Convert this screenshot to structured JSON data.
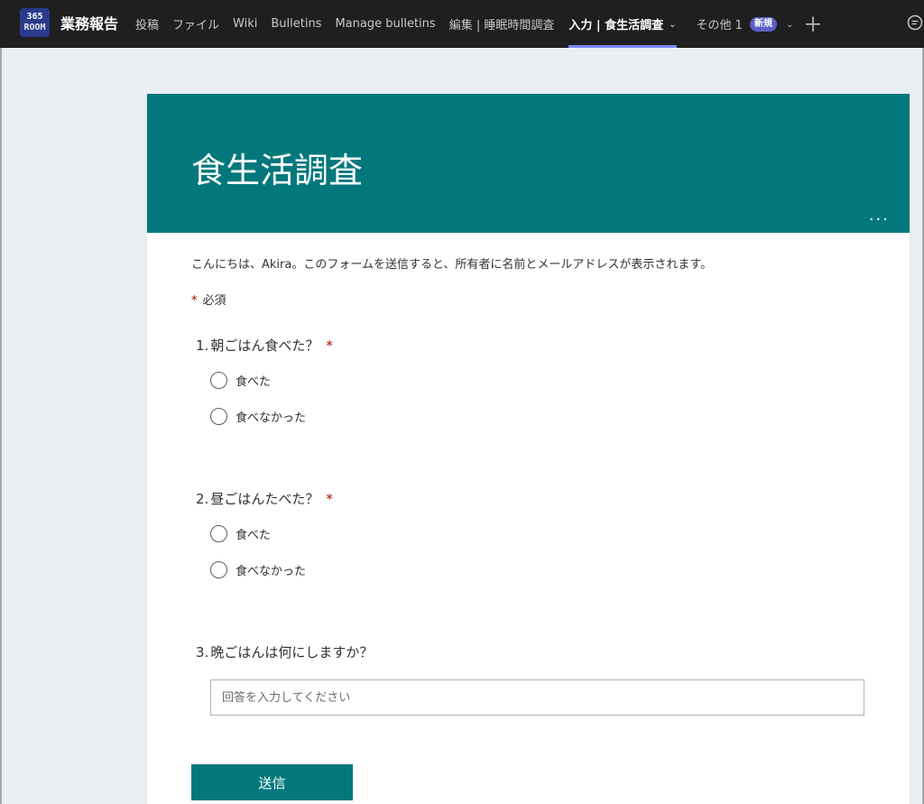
{
  "app": {
    "logo_line1": "365",
    "logo_line2": "ROOM",
    "team_name": "業務報告"
  },
  "tabs": [
    {
      "label": "投稿"
    },
    {
      "label": "ファイル"
    },
    {
      "label": "Wiki"
    },
    {
      "label": "Bulletins"
    },
    {
      "label": "Manage bulletins"
    },
    {
      "label": "編集 | 睡眠時間調査"
    },
    {
      "label": "入力 | 食生活調査",
      "active": true
    },
    {
      "label": "その他 1",
      "badge": "新規"
    }
  ],
  "icons": {
    "add_tab": "plus-icon",
    "chat": "chat-bubble-icon",
    "more": "ellipsis-icon",
    "chevron": "chevron-down-icon"
  },
  "colors": {
    "topbar": "#1f1f1f",
    "accent_tab": "#7f85f5",
    "form_theme": "#03787c",
    "required": "#a80000",
    "badge": "#5b5fc7"
  },
  "form": {
    "title": "食生活調査",
    "more_label": "...",
    "intro": "こんにちは、Akira。このフォームを送信すると、所有者に名前とメールアドレスが表示されます。",
    "required_note": "必須",
    "required_mark": "*",
    "questions": [
      {
        "number": "1.",
        "text": "朝ごはん食べた？",
        "required": true,
        "options": [
          "食べた",
          "食べなかった"
        ]
      },
      {
        "number": "2.",
        "text": "昼ごはんたべた？",
        "required": true,
        "options": [
          "食べた",
          "食べなかった"
        ]
      },
      {
        "number": "3.",
        "text": "晩ごはんは何にしますか？",
        "required": false,
        "placeholder": "回答を入力してください",
        "value": ""
      }
    ],
    "submit_label": "送信"
  }
}
